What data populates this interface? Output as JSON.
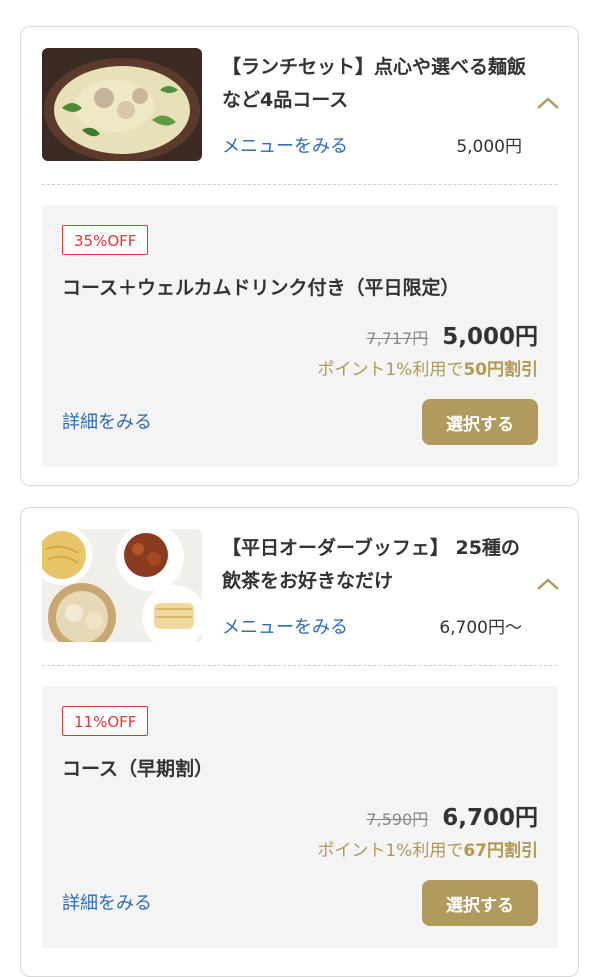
{
  "colors": {
    "accent_gold": "#b09a5d",
    "link_blue": "#2f6db5",
    "badge_red": "#d93a3a"
  },
  "courses": [
    {
      "title": "【ランチセット】点心や選べる麺飯など4品コース",
      "menu_link": "メニューをみる",
      "price": "5,000円",
      "plan": {
        "discount": "35%OFF",
        "name": "コース＋ウェルカムドリンク付き（平日限定）",
        "original_price": "7,717円",
        "price": "5,000円",
        "points_prefix": "ポイント1%利用で",
        "points_discount": "50円割引",
        "detail_link": "詳細をみる",
        "select_label": "選択する"
      }
    },
    {
      "title": "【平日オーダーブッフェ】 25種の飲茶をお好きなだけ",
      "menu_link": "メニューをみる",
      "price": "6,700円〜",
      "plan": {
        "discount": "11%OFF",
        "name": "コース（早期割）",
        "original_price": "7,590円",
        "price": "6,700円",
        "points_prefix": "ポイント1%利用で",
        "points_discount": "67円割引",
        "detail_link": "詳細をみる",
        "select_label": "選択する"
      }
    }
  ]
}
